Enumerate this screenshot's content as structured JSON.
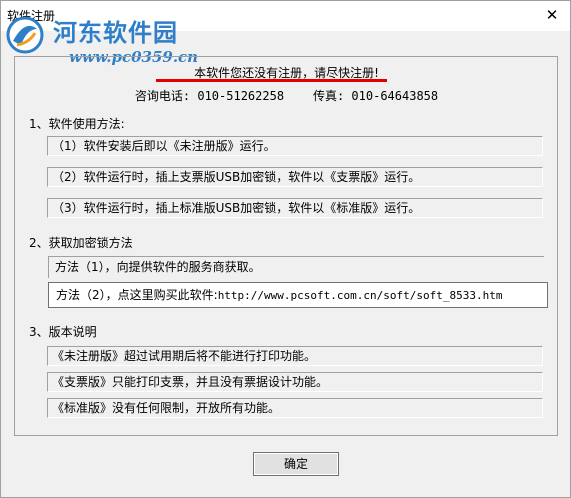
{
  "window": {
    "title": "软件注册",
    "close_glyph": "✕"
  },
  "watermark": {
    "name": "河东软件园",
    "url": "www.pc0359.cn"
  },
  "notice": {
    "text": "本软件您还没有注册，请尽快注册!",
    "underline_color": "#e00000"
  },
  "contact": {
    "phone_label": "咨询电话:",
    "phone": "010-51262258",
    "fax_label": "传真:",
    "fax": "010-64643858"
  },
  "usage": {
    "title": "1、软件使用方法:",
    "items": [
      "（1）软件安装后即以《未注册版》运行。",
      "（2）软件运行时，插上支票版USB加密锁，软件以《支票版》运行。",
      "（3）软件运行时，插上标准版USB加密锁，软件以《标准版》运行。"
    ]
  },
  "acquire": {
    "title": "2、获取加密锁方法",
    "method1": "方法（1），向提供软件的服务商获取。",
    "method2_prefix": "方法（2），点这里购买此软件:",
    "method2_url": "http://www.pcsoft.com.cn/soft/soft_8533.htm"
  },
  "versions": {
    "title": "3、版本说明",
    "items": [
      "《未注册版》超过试用期后将不能进行打印功能。",
      "《支票版》只能打印支票，并且没有票据设计功能。",
      "《标准版》没有任何限制，开放所有功能。"
    ]
  },
  "ok_label": "确定",
  "colors": {
    "watermark_blue": "#2e7ec8",
    "dialog_bg": "#f0f0f0"
  }
}
